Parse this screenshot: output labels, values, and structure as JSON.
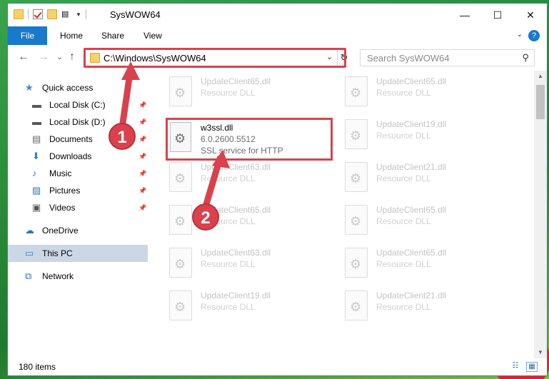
{
  "window": {
    "title": "SysWOW64",
    "controls": {
      "minimize": "—",
      "maximize": "☐",
      "close": "✕"
    }
  },
  "ribbon": {
    "tabs": [
      "File",
      "Home",
      "Share",
      "View"
    ],
    "help": "?"
  },
  "nav": {
    "back": "←",
    "forward": "→",
    "recent": "⌄",
    "up": "↑",
    "address": "C:\\Windows\\SysWOW64",
    "search_placeholder": "Search SysWOW64"
  },
  "sidebar": {
    "items": [
      {
        "label": "Quick access",
        "icon": "star-icon",
        "pinned": false
      },
      {
        "label": "Local Disk (C:)",
        "icon": "drive-icon",
        "pinned": true
      },
      {
        "label": "Local Disk (D:)",
        "icon": "drive-icon",
        "pinned": true
      },
      {
        "label": "Documents",
        "icon": "documents-icon",
        "pinned": true
      },
      {
        "label": "Downloads",
        "icon": "download-icon",
        "pinned": true
      },
      {
        "label": "Music",
        "icon": "music-icon",
        "pinned": true
      },
      {
        "label": "Pictures",
        "icon": "pictures-icon",
        "pinned": true
      },
      {
        "label": "Videos",
        "icon": "videos-icon",
        "pinned": true
      },
      {
        "label": "OneDrive",
        "icon": "cloud-icon",
        "pinned": false
      },
      {
        "label": "This PC",
        "icon": "computer-icon",
        "pinned": false,
        "selected": true
      },
      {
        "label": "Network",
        "icon": "network-icon",
        "pinned": false
      }
    ]
  },
  "files": [
    {
      "name": "UpdateClient65.dll",
      "type": "Resource DLL"
    },
    {
      "name": "UpdateClient65.dll",
      "type": "Resource DLL"
    },
    {
      "name": "UpdateClient19.dll",
      "type": "Resource DLL"
    },
    {
      "name": "UpdateClient63.dll",
      "type": "Resource DLL"
    },
    {
      "name": "UpdateClient21.dll",
      "type": "Resource DLL"
    },
    {
      "name": "UpdateClient65.dll",
      "type": "Resource DLL"
    },
    {
      "name": "UpdateClient65.dll",
      "type": "Resource DLL"
    },
    {
      "name": "UpdateClient63.dll",
      "type": "Resource DLL"
    },
    {
      "name": "UpdateClient65.dll",
      "type": "Resource DLL"
    },
    {
      "name": "UpdateClient19.dll",
      "type": "Resource DLL"
    },
    {
      "name": "UpdateClient21.dll",
      "type": "Resource DLL"
    }
  ],
  "highlighted_file": {
    "name": "w3ssl.dll",
    "version": "6.0.2600.5512",
    "description": "SSL service for HTTP"
  },
  "status": {
    "item_count": "180 items"
  },
  "callouts": {
    "one": "1",
    "two": "2"
  },
  "colors": {
    "accent": "#1979ca",
    "annotation": "#d9424d",
    "selected": "#ccd7e5"
  }
}
